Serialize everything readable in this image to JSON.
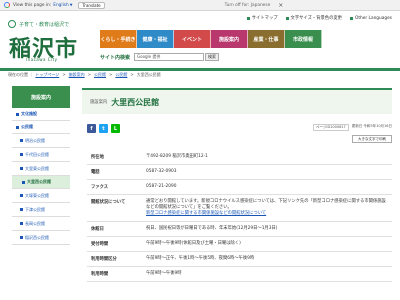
{
  "translate_bar": {
    "prompt": "View this page in:",
    "language": "English",
    "translate_button": "Translate",
    "option": "Turn off for: Japanese"
  },
  "header": {
    "tagline": "子育て・教育は稲沢で",
    "city_name": "稲沢市",
    "city_en": "Inazawa City",
    "util_links": [
      "サイトマップ",
      "文字サイズ・背景色の変更",
      "Other Languages"
    ],
    "nav": [
      {
        "label": "くらし・手続き",
        "color": "#e07b1a"
      },
      {
        "label": "健康・福祉",
        "color": "#2f8ac8"
      },
      {
        "label": "イベント",
        "color": "#d24a4a"
      },
      {
        "label": "施設案内",
        "color": "#b8386e"
      },
      {
        "label": "産業・仕事",
        "color": "#8a6e2f"
      },
      {
        "label": "市政情報",
        "color": "#3a8f4e"
      }
    ],
    "search_label": "サイト内検索",
    "search_placeholder": "Google 提供",
    "search_button": "検索"
  },
  "breadcrumb": [
    "現在の位置",
    "トップページ",
    "施設案内",
    "公民館",
    "公民館",
    "大里西公民館"
  ],
  "sidebar": {
    "title": "施設案内",
    "items": [
      {
        "label": "文化施設",
        "level": 1
      },
      {
        "label": "公民館",
        "level": 1
      },
      {
        "label": "明治公民館",
        "level": 2
      },
      {
        "label": "千代田公民館",
        "level": 2
      },
      {
        "label": "大里東公民館",
        "level": 2
      },
      {
        "label": "大里西公民館",
        "level": 3,
        "active": true
      },
      {
        "label": "大塚東公民館",
        "level": 2
      },
      {
        "label": "下津公民館",
        "level": 2
      },
      {
        "label": "長岡公民館",
        "level": 2
      },
      {
        "label": "稲沢西公民館",
        "level": 2
      }
    ]
  },
  "page": {
    "category": "施設案内",
    "title": "大里西公民館",
    "page_id": "ページID1000617",
    "updated": "更新日 令和5年10月16日",
    "print_button": "大きな文字で印刷"
  },
  "table": [
    {
      "key": "所在地",
      "value": "〒492-8209 稲沢市奥田町12-1"
    },
    {
      "key": "電話",
      "value": "0587-32-0903"
    },
    {
      "key": "ファクス",
      "value": "0587-21-2090"
    },
    {
      "key": "開館状況について",
      "value": "通常どおり開館しています。新規コロナウイルス感染症については、下記リンク先の「新型コロナ感染症に関する市関係施設などの開館状況について」をご覧ください。",
      "link": "新型コロナ感染症に関する市関係施設などの開館状況について"
    },
    {
      "key": "休館日",
      "value": "祝日、国民祝日等が日曜日である時、年末年始(12月29日～1月3日)"
    },
    {
      "key": "受付時間",
      "value": "午前9時～午後9時(休館日及び土曜・日曜は除く)"
    },
    {
      "key": "利用時間区分",
      "value": "午前9時～正午、午後1時～午後5時、夜間6時～午後9時"
    },
    {
      "key": "利用時間",
      "value": "午前9時～午後9時"
    }
  ]
}
